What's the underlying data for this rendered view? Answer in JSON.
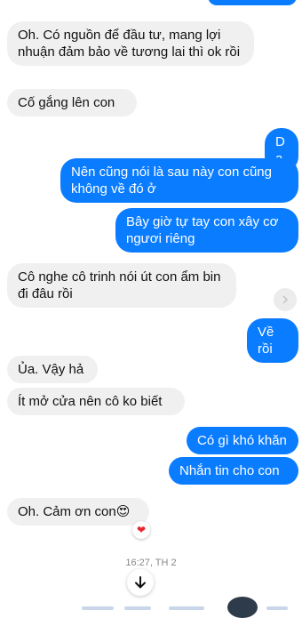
{
  "messages": [
    {
      "side": "in",
      "text": "Oh. Có nguồn để đầu tư, mang lợi nhuận đảm bảo về tương lai thì ok rồi"
    },
    {
      "side": "in",
      "text": "Cố gắng lên con"
    },
    {
      "side": "out",
      "text": "Dạ"
    },
    {
      "side": "out",
      "text": "Nên cũng nói là sau này con cũng không về đó ở"
    },
    {
      "side": "out",
      "text": "Bây giờ tự tay con xây cơ ngươi riêng"
    },
    {
      "side": "in",
      "text": "Cô nghe cô trinh nói út con ẩm bin đi đâu rồi"
    },
    {
      "side": "out",
      "text": "Về rồi"
    },
    {
      "side": "in",
      "text": "Ủa. Vậy hả"
    },
    {
      "side": "in",
      "text": "Ít mở cửa nên cô ko biết"
    },
    {
      "side": "out",
      "text": "Có gì khó khăn"
    },
    {
      "side": "out",
      "text": "Nhắn tin cho con"
    },
    {
      "side": "in",
      "text": "Oh. Cảm ơn con😍"
    }
  ],
  "reaction": "❤",
  "timestamp": "16:27, TH 2",
  "icons": {
    "scroll": "chevron-right-icon",
    "down": "arrow-down-icon",
    "reaction": "heart-icon"
  },
  "colors": {
    "outgoing_bubble": "#0a7cff",
    "incoming_bubble": "#f0f0f0",
    "reaction_heart": "#e8262f"
  }
}
